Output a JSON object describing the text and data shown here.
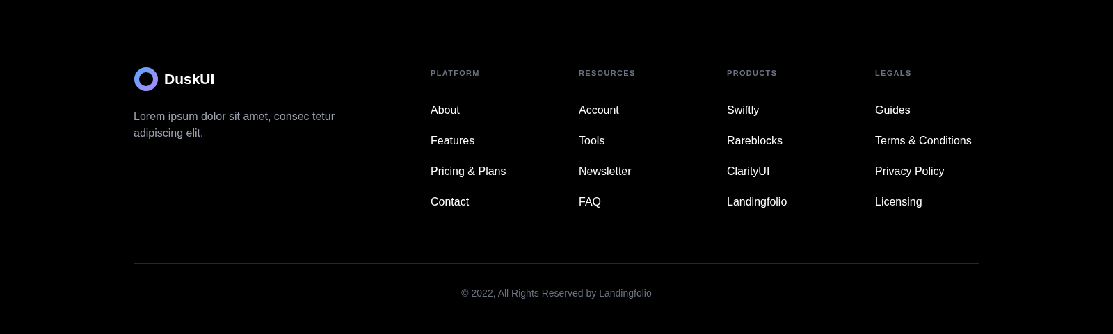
{
  "brand": {
    "name": "DuskUI",
    "tagline": "Lorem ipsum dolor sit amet, consec tetur adipiscing elit."
  },
  "columns": [
    {
      "heading": "PLATFORM",
      "links": [
        "About",
        "Features",
        "Pricing & Plans",
        "Contact"
      ]
    },
    {
      "heading": "RESOURCES",
      "links": [
        "Account",
        "Tools",
        "Newsletter",
        "FAQ"
      ]
    },
    {
      "heading": "PRODUCTS",
      "links": [
        "Swiftly",
        "Rareblocks",
        "ClarityUI",
        "Landingfolio"
      ]
    },
    {
      "heading": "LEGALS",
      "links": [
        "Guides",
        "Terms & Conditions",
        "Privacy Policy",
        "Licensing"
      ]
    }
  ],
  "copyright": "© 2022, All Rights Reserved by Landingfolio"
}
